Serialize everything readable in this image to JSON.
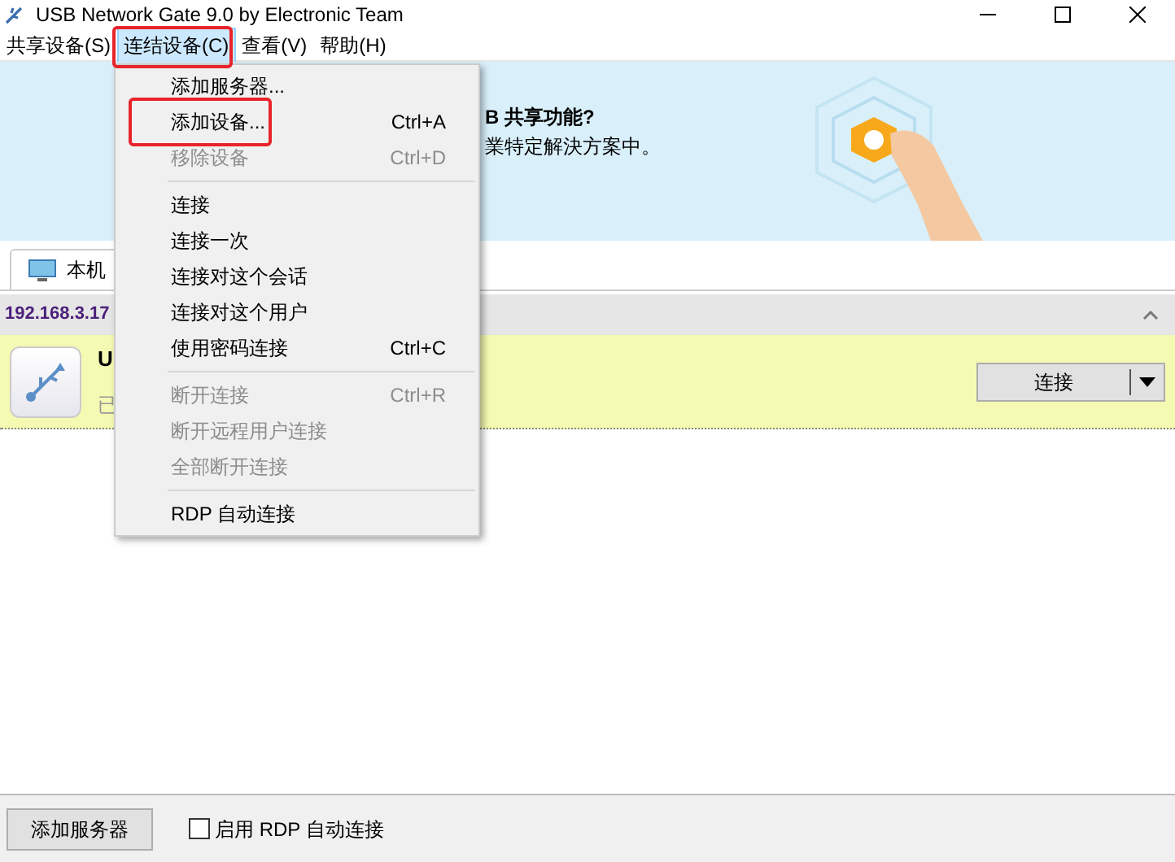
{
  "window": {
    "title": "USB Network Gate 9.0 by Electronic Team"
  },
  "menubar": [
    {
      "label": "共享设备(S)",
      "selected": false
    },
    {
      "label": "连结设备(C)",
      "selected": true
    },
    {
      "label": "查看(V)",
      "selected": false
    },
    {
      "label": "帮助(H)",
      "selected": false
    }
  ],
  "banner": {
    "title": "B 共享功能?",
    "text": "業特定解決方案中。"
  },
  "tabs": [
    {
      "label": "本机",
      "selected": true
    }
  ],
  "group": {
    "title": "192.168.3.17"
  },
  "device": {
    "name": "U",
    "status": "已",
    "button": "连接"
  },
  "menu": [
    {
      "kind": "item",
      "label": "添加服务器...",
      "disabled": false
    },
    {
      "kind": "item",
      "label": "添加设备...",
      "shortcut": "Ctrl+A",
      "disabled": false
    },
    {
      "kind": "item",
      "label": "移除设备",
      "shortcut": "Ctrl+D",
      "disabled": true
    },
    {
      "kind": "separator"
    },
    {
      "kind": "item",
      "label": "连接",
      "disabled": false
    },
    {
      "kind": "item",
      "label": "连接一次",
      "disabled": false
    },
    {
      "kind": "item",
      "label": "连接对这个会话",
      "disabled": false
    },
    {
      "kind": "item",
      "label": "连接对这个用户",
      "disabled": false
    },
    {
      "kind": "item",
      "label": "使用密码连接",
      "shortcut": "Ctrl+C",
      "disabled": false
    },
    {
      "kind": "separator"
    },
    {
      "kind": "item",
      "label": "断开连接",
      "shortcut": "Ctrl+R",
      "disabled": true
    },
    {
      "kind": "item",
      "label": "断开远程用户连接",
      "disabled": true
    },
    {
      "kind": "item",
      "label": "全部断开连接",
      "disabled": true
    },
    {
      "kind": "separator"
    },
    {
      "kind": "item",
      "label": "RDP 自动连接",
      "disabled": false
    }
  ],
  "footer": {
    "button": "添加服务器",
    "checkbox": {
      "label": "启用 RDP 自动连接",
      "checked": false
    }
  }
}
